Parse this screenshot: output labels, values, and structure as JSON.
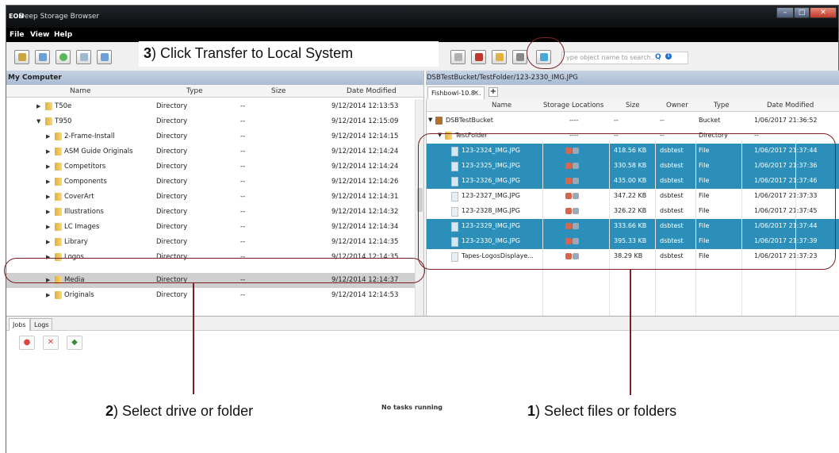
{
  "window": {
    "logo": "EON",
    "title": "Deep Storage Browser"
  },
  "menu": [
    "File",
    "View",
    "Help"
  ],
  "toolbar": {
    "search_placeholder": "ype object name to search..."
  },
  "left_pane": {
    "title": "My Computer",
    "columns": [
      "Name",
      "Type",
      "Size",
      "Date Modified"
    ],
    "rows": [
      {
        "name": "T50e",
        "type": "Directory",
        "size": "--",
        "date": "9/12/2014 12:13:53",
        "level": 1,
        "expanded": false
      },
      {
        "name": "T950",
        "type": "Directory",
        "size": "--",
        "date": "9/12/2014 12:15:09",
        "level": 1,
        "expanded": true
      },
      {
        "name": "2-Frame-Install",
        "type": "Directory",
        "size": "--",
        "date": "9/12/2014 12:14:15",
        "level": 2,
        "expanded": false
      },
      {
        "name": "ASM Guide Originals",
        "type": "Directory",
        "size": "--",
        "date": "9/12/2014 12:14:24",
        "level": 2,
        "expanded": false
      },
      {
        "name": "Competitors",
        "type": "Directory",
        "size": "--",
        "date": "9/12/2014 12:14:24",
        "level": 2,
        "expanded": false
      },
      {
        "name": "Components",
        "type": "Directory",
        "size": "--",
        "date": "9/12/2014 12:14:26",
        "level": 2,
        "expanded": false
      },
      {
        "name": "CoverArt",
        "type": "Directory",
        "size": "--",
        "date": "9/12/2014 12:14:31",
        "level": 2,
        "expanded": false
      },
      {
        "name": "Illustrations",
        "type": "Directory",
        "size": "--",
        "date": "9/12/2014 12:14:32",
        "level": 2,
        "expanded": false
      },
      {
        "name": "LC Images",
        "type": "Directory",
        "size": "--",
        "date": "9/12/2014 12:14:34",
        "level": 2,
        "expanded": false
      },
      {
        "name": "Library",
        "type": "Directory",
        "size": "--",
        "date": "9/12/2014 12:14:35",
        "level": 2,
        "expanded": false
      },
      {
        "name": "Logos",
        "type": "Directory",
        "size": "--",
        "date": "9/12/2014 12:14:35",
        "level": 2,
        "expanded": false
      },
      {
        "name": "Media",
        "type": "Directory",
        "size": "--",
        "date": "9/12/2014 12:14:37",
        "level": 2,
        "expanded": false,
        "selected": true
      },
      {
        "name": "Originals",
        "type": "Directory",
        "size": "--",
        "date": "9/12/2014 12:14:53",
        "level": 2,
        "expanded": false
      }
    ]
  },
  "right_pane": {
    "path": "DSBTestBucket/TestFolder/123-2330_IMG.JPG",
    "tab_label": "Fishbowl-10.8...",
    "tab_close": "×",
    "add_tab": "+",
    "columns": [
      "Name",
      "Storage Locations",
      "Size",
      "Owner",
      "Type",
      "Date Modified"
    ],
    "rows": [
      {
        "name": "DSBTestBucket",
        "storage": "----",
        "size": "--",
        "owner": "--",
        "type": "Bucket",
        "date": "1/06/2017 21:36:52",
        "kind": "bucket",
        "selected": false
      },
      {
        "name": "TestFolder",
        "storage": "----",
        "size": "--",
        "owner": "--",
        "type": "Directory",
        "date": "--",
        "kind": "folder",
        "selected": false
      },
      {
        "name": "123-2324_IMG.JPG",
        "storage": "icons",
        "size": "418.56 KB",
        "owner": "dsbtest",
        "type": "File",
        "date": "1/06/2017 21:37:44",
        "kind": "file",
        "selected": true
      },
      {
        "name": "123-2325_IMG.JPG",
        "storage": "icons",
        "size": "330.58 KB",
        "owner": "dsbtest",
        "type": "File",
        "date": "1/06/2017 21:37:36",
        "kind": "file",
        "selected": true
      },
      {
        "name": "123-2326_IMG.JPG",
        "storage": "icons",
        "size": "435.00 KB",
        "owner": "dsbtest",
        "type": "File",
        "date": "1/06/2017 21:37:46",
        "kind": "file",
        "selected": true
      },
      {
        "name": "123-2327_IMG.JPG",
        "storage": "icons",
        "size": "347.22 KB",
        "owner": "dsbtest",
        "type": "File",
        "date": "1/06/2017 21:37:33",
        "kind": "file",
        "selected": false
      },
      {
        "name": "123-2328_IMG.JPG",
        "storage": "icons",
        "size": "326.22 KB",
        "owner": "dsbtest",
        "type": "File",
        "date": "1/06/2017 21:37:45",
        "kind": "file",
        "selected": false
      },
      {
        "name": "123-2329_IMG.JPG",
        "storage": "icons",
        "size": "333.66 KB",
        "owner": "dsbtest",
        "type": "File",
        "date": "1/06/2017 21:37:44",
        "kind": "file",
        "selected": true
      },
      {
        "name": "123-2330_IMG.JPG",
        "storage": "icons",
        "size": "395.33 KB",
        "owner": "dsbtest",
        "type": "File",
        "date": "1/06/2017 21:37:39",
        "kind": "file",
        "selected": true
      },
      {
        "name": "Tapes-LogosDisplaye...",
        "storage": "icons",
        "size": "38.29 KB",
        "owner": "dsbtest",
        "type": "File",
        "date": "1/06/2017 21:37:23",
        "kind": "file",
        "selected": false
      }
    ]
  },
  "bottom": {
    "tabs": [
      "Jobs",
      "Logs"
    ],
    "status": "No tasks running"
  },
  "annotations": {
    "step1_num": "1",
    "step1_text": ") Select files or folders",
    "step2_num": "2",
    "step2_text": ") Select drive or folder",
    "step3_num": "3",
    "step3_text": ") Click Transfer to Local System"
  },
  "colors": {
    "selection": "#2b8fb9",
    "callout": "#7a2020",
    "pane_title": "#b8c8dc"
  }
}
